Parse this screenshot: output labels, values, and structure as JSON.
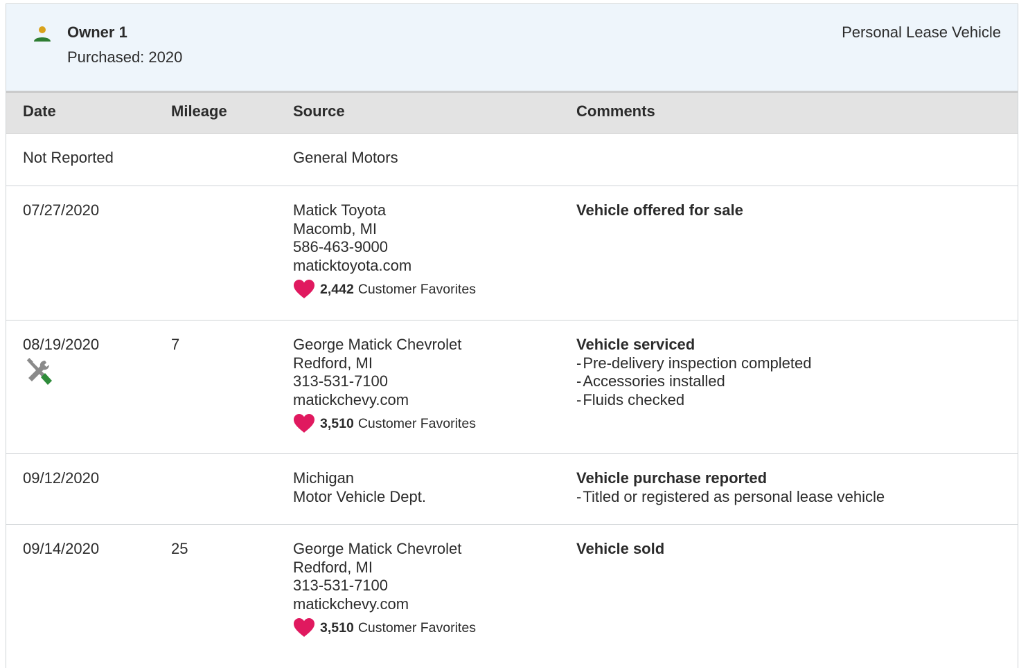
{
  "owner": {
    "name": "Owner 1",
    "purchased": "Purchased: 2020",
    "vehicle_type": "Personal Lease Vehicle",
    "icon": "person-icon"
  },
  "columns": {
    "date": "Date",
    "mileage": "Mileage",
    "source": "Source",
    "comments": "Comments"
  },
  "colors": {
    "heart": "#e0195f",
    "person_head": "#d9a21b",
    "person_body": "#2e7d32",
    "service_green": "#2e8b3a"
  },
  "records": [
    {
      "date": "Not Reported",
      "mileage": "",
      "source": [
        "General Motors"
      ],
      "favorites": null,
      "comment_title": "",
      "comment_items": []
    },
    {
      "date": "07/27/2020",
      "mileage": "",
      "source": [
        "Matick Toyota",
        "Macomb, MI",
        "586-463-9000",
        "maticktoyota.com"
      ],
      "favorites": {
        "count": "2,442",
        "label": "Customer Favorites"
      },
      "comment_title": "Vehicle offered for sale",
      "comment_items": []
    },
    {
      "date": "08/19/2020",
      "service_icon": "service-tools-icon",
      "mileage": "7",
      "source": [
        "George Matick Chevrolet",
        "Redford, MI",
        "313-531-7100",
        "matickchevy.com"
      ],
      "favorites": {
        "count": "3,510",
        "label": "Customer Favorites"
      },
      "comment_title": "Vehicle serviced",
      "comment_items": [
        "Pre-delivery inspection completed",
        "Accessories installed",
        "Fluids checked"
      ]
    },
    {
      "date": "09/12/2020",
      "mileage": "",
      "source": [
        "Michigan",
        "Motor Vehicle Dept."
      ],
      "favorites": null,
      "comment_title": "Vehicle purchase reported",
      "comment_items": [
        "Titled or registered as personal lease vehicle"
      ]
    },
    {
      "date": "09/14/2020",
      "mileage": "25",
      "source": [
        "George Matick Chevrolet",
        "Redford, MI",
        "313-531-7100",
        "matickchevy.com"
      ],
      "favorites": {
        "count": "3,510",
        "label": "Customer Favorites"
      },
      "comment_title": "Vehicle sold",
      "comment_items": []
    }
  ]
}
